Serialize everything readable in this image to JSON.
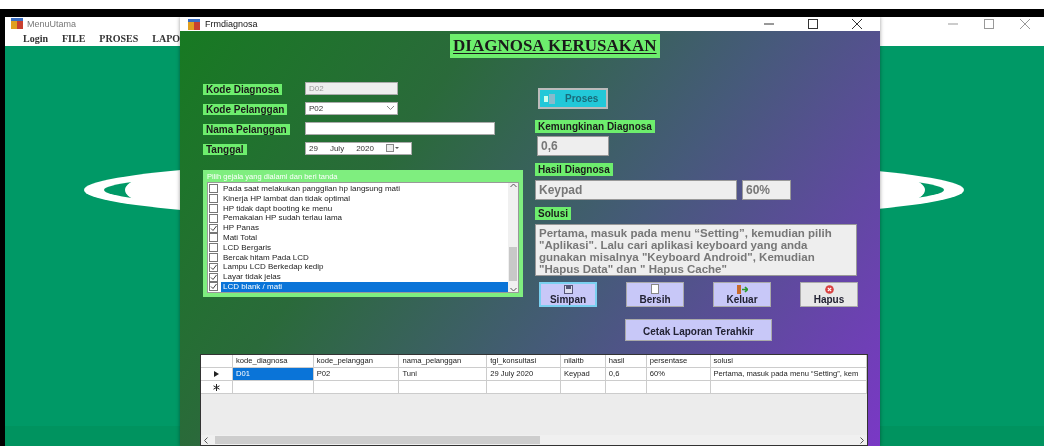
{
  "main_window": {
    "title": "MenuUtama",
    "menu": [
      "Login",
      "FILE",
      "PROSES",
      "LAPO"
    ]
  },
  "form": {
    "title": "Frmdiagnosa",
    "heading": "DIAGNOSA KERUSAKAN",
    "fields": [
      {
        "kind": "text",
        "label": "Kode Diagnosa",
        "value": "D02",
        "disabled": true
      },
      {
        "kind": "combo",
        "label": "Kode Pelanggan",
        "value": "P02",
        "disabled": false
      },
      {
        "kind": "text",
        "label": "Nama Pelanggan",
        "disabled": false
      },
      {
        "kind": "date",
        "label": "Tanggal",
        "day": "29",
        "month": "July",
        "year": "2020"
      }
    ],
    "symptoms": {
      "title": "Pilih gejala yang dialami dan beri tanda",
      "items": [
        {
          "label": "Pada saat melakukan panggilan hp langsung mati",
          "checked": false,
          "selected": false
        },
        {
          "label": "Kinerja HP lambat dan tidak optimal",
          "checked": false,
          "selected": false
        },
        {
          "label": "HP tidak dapt booting ke menu",
          "checked": false,
          "selected": false
        },
        {
          "label": "Pemakaian HP sudah terlau lama",
          "checked": false,
          "selected": false
        },
        {
          "label": "HP Panas",
          "checked": true,
          "selected": false
        },
        {
          "label": "Mati Total",
          "checked": false,
          "selected": false
        },
        {
          "label": "LCD Bergaris",
          "checked": false,
          "selected": false
        },
        {
          "label": "Bercak hitam Pada LCD",
          "checked": false,
          "selected": false
        },
        {
          "label": "Lampu LCD Berkedap kedip",
          "checked": true,
          "selected": false
        },
        {
          "label": "Layar tidak jelas",
          "checked": true,
          "selected": false
        },
        {
          "label": "LCD blank / mati",
          "checked": true,
          "selected": true
        }
      ]
    },
    "process_button": "Proses",
    "possibility": {
      "label": "Kemungkinan Diagnosa",
      "value": "0,6"
    },
    "result": {
      "label": "Hasil Diagnosa",
      "value": "Keypad",
      "percent": "60%"
    },
    "solution": {
      "label": "Solusi",
      "text": "Pertama, masuk pada menu “Setting”, kemudian pilih \"Aplikasi\". Lalu cari aplikasi keyboard yang anda gunakan misalnya \"Keyboard Android\", Kemudian \"Hapus Data\" dan \" Hapus Cache\""
    },
    "buttons": [
      {
        "kind": "save",
        "label": "Simpan",
        "focused": true
      },
      {
        "kind": "clear",
        "label": "Bersih",
        "focused": false
      },
      {
        "kind": "exit",
        "label": "Keluar",
        "focused": false
      },
      {
        "kind": "delete",
        "label": "Hapus",
        "focused": false
      }
    ],
    "print_button": "Cetak Laporan Terahkir",
    "table": {
      "columns": [
        "kode_diagnosa",
        "kode_pelanggan",
        "nama_pelanggan",
        "tgl_konsultasi",
        "nilaitb",
        "hasil",
        "persentase",
        "solusi"
      ],
      "rows": [
        {
          "cells": [
            {
              "text": "D01",
              "selected": true
            },
            {
              "text": "P02",
              "selected": false
            },
            {
              "text": "Tuni",
              "selected": false
            },
            {
              "text": "29 July 2020",
              "selected": false
            },
            {
              "text": "Keypad",
              "selected": false
            },
            {
              "text": "0,6",
              "selected": false
            },
            {
              "text": "60%",
              "selected": false
            },
            {
              "text": "Pertama, masuk pada menu “Setting”, kem",
              "selected": false
            }
          ]
        }
      ]
    }
  }
}
